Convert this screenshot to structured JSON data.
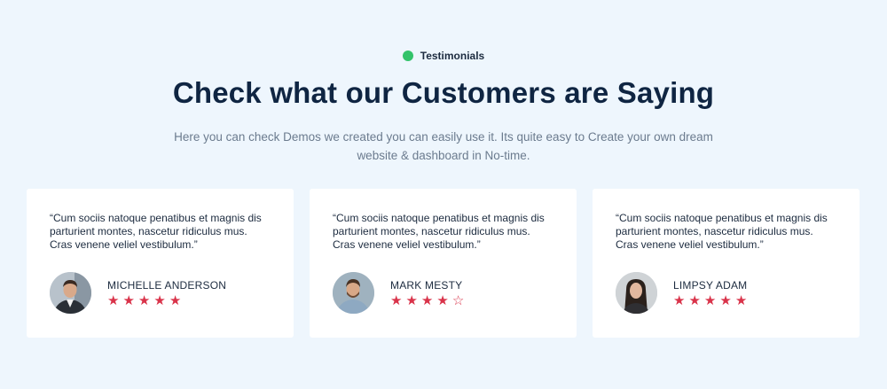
{
  "eyebrow": {
    "label": "Testimonials",
    "dot_color": "#33c36a"
  },
  "title": "Check what our Customers are Saying",
  "subtitle": "Here you can check Demos we created you can easily use it. Its quite easy to Create your own dream website & dashboard in No-time.",
  "testimonials": [
    {
      "quote": "“Cum sociis natoque penatibus et magnis dis parturient montes, nascetur ridiculus mus. Cras venene veliel vestibulum.”",
      "name": "MICHELLE ANDERSON",
      "rating": 5,
      "max_rating": 5
    },
    {
      "quote": "“Cum sociis natoque penatibus et magnis dis parturient montes, nascetur ridiculus mus. Cras venene veliel vestibulum.”",
      "name": "MARK MESTY",
      "rating": 4,
      "max_rating": 5
    },
    {
      "quote": "“Cum sociis natoque penatibus et magnis dis parturient montes, nascetur ridiculus mus. Cras venene veliel vestibulum.”",
      "name": "LIMPSY ADAM",
      "rating": 5,
      "max_rating": 5
    }
  ],
  "colors": {
    "star": "#d9334a",
    "heading": "#0f2542",
    "background": "#eef6fd"
  }
}
